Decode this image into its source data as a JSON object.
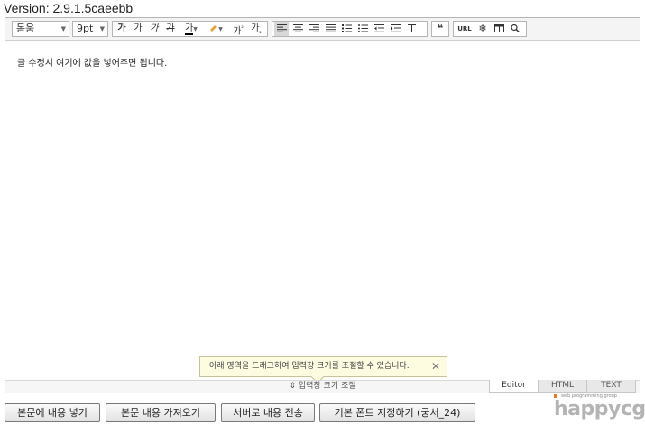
{
  "version": "Version: 2.9.1.5caeebb",
  "toolbar": {
    "font_family": "돋움",
    "font_size": "9pt",
    "buttons": {
      "bold": "가",
      "underline": "가",
      "italic": "가",
      "strike": "가",
      "font_color": "가",
      "superscript": "가",
      "subscript": "가",
      "url": "URL",
      "quote": "❝"
    }
  },
  "content": {
    "text": "글 수정시 여기에 값을 넣어주면 됩니다."
  },
  "tooltip": {
    "text": "아래 영역을 드래그하여 입력창 크기를 조절할 수 있습니다."
  },
  "resize": {
    "label": "입력창 크기 조절"
  },
  "modes": [
    "Editor",
    "HTML",
    "TEXT"
  ],
  "actions": [
    "본문에 내용 넣기",
    "본문 내용 가져오기",
    "서버로 내용 전송",
    "기본 폰트 지정하기 (궁서_24)"
  ],
  "logo": {
    "tagline": "web programming group",
    "word": "happycgi"
  },
  "colors": {
    "accent": "#e07b2a",
    "border": "#b5b5b5",
    "tooltip_bg": "#fdfbe0"
  }
}
